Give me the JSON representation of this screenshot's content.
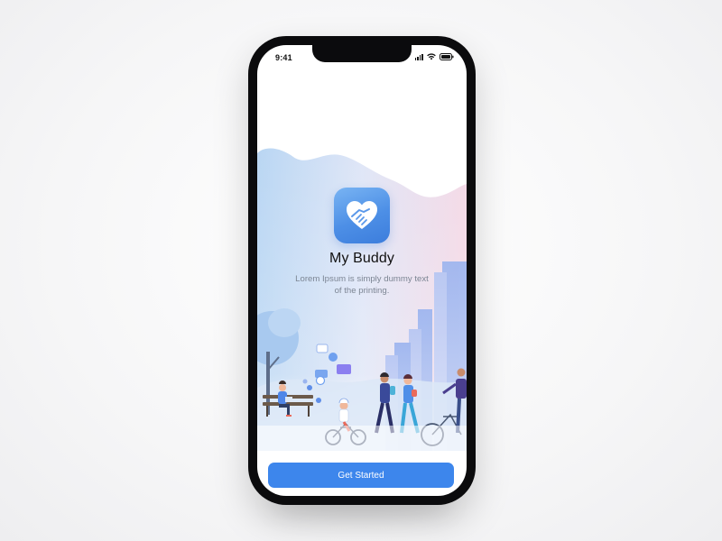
{
  "status_bar": {
    "time": "9:41",
    "icons": [
      "cellular-signal-icon",
      "wifi-icon",
      "battery-icon"
    ]
  },
  "app": {
    "icon": "heart-handshake-icon",
    "title": "My Buddy",
    "subtitle": "Lorem Ipsum is simply dummy text of the printing."
  },
  "illustration": {
    "description": "park",
    "floating_icons": [
      "heart-icon",
      "chat-icon",
      "user-icon",
      "play-icon",
      "location-icon",
      "message-icon"
    ]
  },
  "cta": {
    "label": "Get Started"
  },
  "colors": {
    "accent": "#3d86ec",
    "icon_gradient_top": "#79b4f3",
    "icon_gradient_bottom": "#3c7ddc",
    "phone_body": "#0b0b0d",
    "subtitle_text": "#7c8593"
  }
}
